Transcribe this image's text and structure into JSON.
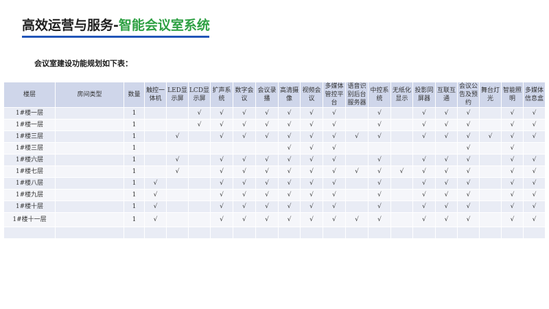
{
  "header": {
    "title_main": "高效运营与服务-",
    "title_accent": "智能会议室系统",
    "subtitle": "会议室建设功能规划如下表："
  },
  "colors": {
    "accent_green": "#2ea043",
    "underline_blue": "#2155b8",
    "table_header_bg": "#cfd6ea"
  },
  "table": {
    "columns": [
      "楼层",
      "房间类型",
      "数量",
      "触控一体机",
      "LED显示屏",
      "LCD显示屏",
      "扩声系统",
      "数字会议",
      "会议录播",
      "高清摄像",
      "视频会议",
      "多媒体管控平台",
      "语音识别后台服务器",
      "中控系统",
      "无纸化显示",
      "投影同屏器",
      "互联互通",
      "会议公告及预约",
      "舞台灯光",
      "智能照明",
      "多媒体信息盒"
    ],
    "rows": [
      {
        "cells": [
          "1#楼一层",
          "",
          "1",
          "",
          "",
          "√",
          "√",
          "√",
          "√",
          "√",
          "√",
          "√",
          "",
          "√",
          "",
          "√",
          "√",
          "√",
          "",
          "√",
          "√"
        ]
      },
      {
        "cells": [
          "1#楼一层",
          "",
          "1",
          "",
          "",
          "√",
          "√",
          "√",
          "√",
          "√",
          "√",
          "√",
          "",
          "√",
          "",
          "√",
          "√",
          "√",
          "",
          "√",
          "√"
        ]
      },
      {
        "cells": [
          "1#楼三层",
          "",
          "1",
          "",
          "√",
          "",
          "√",
          "√",
          "√",
          "√",
          "√",
          "√",
          "√",
          "√",
          "",
          "√",
          "√",
          "√",
          "√",
          "√",
          "√"
        ]
      },
      {
        "cells": [
          "1#楼三层",
          "",
          "1",
          "",
          "",
          "",
          "",
          "",
          "",
          "√",
          "√",
          "√",
          "",
          "",
          "",
          "",
          "",
          "√",
          "",
          "√",
          ""
        ]
      },
      {
        "cells": [
          "1#楼六层",
          "",
          "1",
          "",
          "√",
          "",
          "√",
          "√",
          "√",
          "√",
          "√",
          "√",
          "",
          "√",
          "",
          "√",
          "√",
          "√",
          "",
          "√",
          "√"
        ]
      },
      {
        "cells": [
          "1#楼七层",
          "",
          "1",
          "",
          "√",
          "",
          "√",
          "√",
          "√",
          "√",
          "√",
          "√",
          "√",
          "√",
          "√",
          "√",
          "√",
          "√",
          "",
          "√",
          "√"
        ]
      },
      {
        "cells": [
          "1#楼八层",
          "",
          "1",
          "√",
          "",
          "",
          "√",
          "√",
          "√",
          "√",
          "√",
          "√",
          "",
          "√",
          "",
          "√",
          "√",
          "√",
          "",
          "√",
          "√"
        ]
      },
      {
        "cells": [
          "1#楼九层",
          "",
          "1",
          "√",
          "",
          "",
          "√",
          "√",
          "√",
          "√",
          "√",
          "√",
          "",
          "√",
          "",
          "√",
          "√",
          "√",
          "",
          "√",
          "√"
        ]
      },
      {
        "cells": [
          "1#楼十层",
          "",
          "1",
          "√",
          "",
          "",
          "√",
          "√",
          "√",
          "√",
          "√",
          "√",
          "",
          "√",
          "",
          "√",
          "√",
          "√",
          "",
          "√",
          "√"
        ]
      },
      {
        "cells": [
          "1#楼十一层",
          "",
          "1",
          "√",
          "",
          "",
          "√",
          "√",
          "√",
          "√",
          "√",
          "√",
          "√",
          "√",
          "",
          "√",
          "√",
          "√",
          "",
          "√",
          "√"
        ]
      },
      {
        "cells": [
          "",
          "",
          "",
          "",
          "",
          "",
          "",
          "",
          "",
          "",
          "",
          "",
          "",
          "",
          "",
          "",
          "",
          "",
          "",
          "",
          ""
        ]
      }
    ]
  }
}
